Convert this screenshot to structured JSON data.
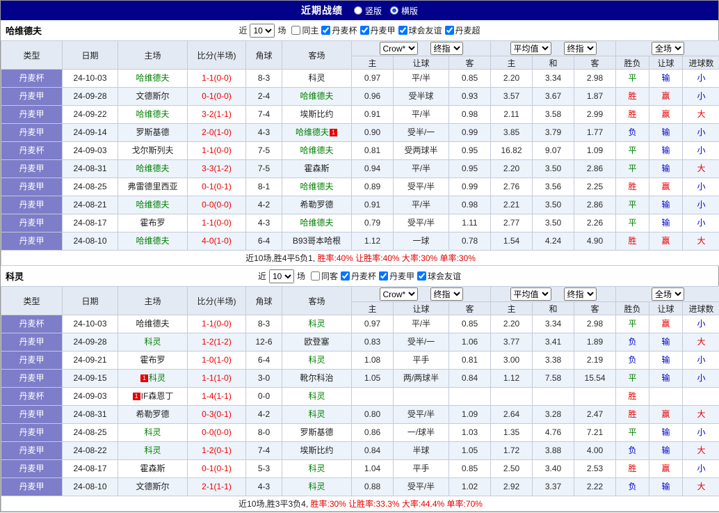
{
  "page": {
    "title": "近期战绩",
    "view_options": [
      {
        "label": "竖版",
        "selected": false
      },
      {
        "label": "横版",
        "selected": true
      }
    ]
  },
  "labels": {
    "near": "近",
    "games": "场"
  },
  "table": {
    "cols": [
      "类型",
      "日期",
      "主场",
      "比分(半场)",
      "角球",
      "客场"
    ],
    "groups": [
      {
        "selects": [
          "Crow*",
          "终指"
        ],
        "sub": [
          "主",
          "让球",
          "客"
        ]
      },
      {
        "selects": [
          "平均值",
          "终指"
        ],
        "sub": [
          "主",
          "和",
          "客"
        ]
      },
      {
        "selects": [
          "全场"
        ],
        "sub": [
          "胜负",
          "让球",
          "进球数"
        ]
      }
    ]
  },
  "result_colors": {
    "胜": "#e60000",
    "负": "#0000cc",
    "平": "#008000",
    "赢": "#e60000",
    "输": "#0000cc",
    "大": "#e60000",
    "小": "#0000cc"
  },
  "sections": [
    {
      "team": "哈维德夫",
      "filter": {
        "count": "10",
        "checkboxes": [
          {
            "label": "同主",
            "checked": false
          },
          {
            "label": "丹麦杯",
            "checked": true
          },
          {
            "label": "丹麦甲",
            "checked": true
          },
          {
            "label": "球会友谊",
            "checked": true
          },
          {
            "label": "丹麦超",
            "checked": true
          }
        ]
      },
      "rows": [
        {
          "type": "丹麦杯",
          "date": "24-10-03",
          "home": "哈维德夫",
          "home_focus": true,
          "score": "1-1(0-0)",
          "corner": "8-3",
          "away": "科灵",
          "odds": [
            "0.97",
            "平/半",
            "0.85"
          ],
          "avg": [
            "2.20",
            "3.34",
            "2.98"
          ],
          "results": [
            "平",
            "输",
            "小"
          ]
        },
        {
          "type": "丹麦甲",
          "date": "24-09-28",
          "home": "文德斯尔",
          "score": "0-1(0-0)",
          "corner": "2-4",
          "away": "哈维德夫",
          "away_focus": true,
          "odds": [
            "0.96",
            "受半球",
            "0.93"
          ],
          "avg": [
            "3.57",
            "3.67",
            "1.87"
          ],
          "results": [
            "胜",
            "赢",
            "小"
          ]
        },
        {
          "type": "丹麦甲",
          "date": "24-09-22",
          "home": "哈维德夫",
          "home_focus": true,
          "score": "3-2(1-1)",
          "corner": "7-4",
          "away": "埃斯比约",
          "odds": [
            "0.91",
            "平/半",
            "0.98"
          ],
          "avg": [
            "2.11",
            "3.58",
            "2.99"
          ],
          "results": [
            "胜",
            "赢",
            "大"
          ]
        },
        {
          "type": "丹麦甲",
          "date": "24-09-14",
          "home": "罗斯基德",
          "score": "2-0(1-0)",
          "corner": "4-3",
          "away": "哈维德夫",
          "away_focus": true,
          "away_badge": {
            "text": "1",
            "pos": "post"
          },
          "odds": [
            "0.90",
            "受半/一",
            "0.99"
          ],
          "avg": [
            "3.85",
            "3.79",
            "1.77"
          ],
          "results": [
            "负",
            "输",
            "小"
          ]
        },
        {
          "type": "丹麦杯",
          "date": "24-09-03",
          "home": "戈尔斯列夫",
          "score": "1-1(0-0)",
          "corner": "7-5",
          "away": "哈维德夫",
          "away_focus": true,
          "odds": [
            "0.81",
            "受两球半",
            "0.95"
          ],
          "avg": [
            "16.82",
            "9.07",
            "1.09"
          ],
          "results": [
            "平",
            "输",
            "小"
          ]
        },
        {
          "type": "丹麦甲",
          "date": "24-08-31",
          "home": "哈维德夫",
          "home_focus": true,
          "score": "3-3(1-2)",
          "corner": "7-5",
          "away": "霍森斯",
          "odds": [
            "0.94",
            "平/半",
            "0.95"
          ],
          "avg": [
            "2.20",
            "3.50",
            "2.86"
          ],
          "results": [
            "平",
            "输",
            "大"
          ]
        },
        {
          "type": "丹麦甲",
          "date": "24-08-25",
          "home": "弗雷德里西亚",
          "score": "0-1(0-1)",
          "corner": "8-1",
          "away": "哈维德夫",
          "away_focus": true,
          "odds": [
            "0.89",
            "受平/半",
            "0.99"
          ],
          "avg": [
            "2.76",
            "3.56",
            "2.25"
          ],
          "results": [
            "胜",
            "赢",
            "小"
          ]
        },
        {
          "type": "丹麦甲",
          "date": "24-08-21",
          "home": "哈维德夫",
          "home_focus": true,
          "score": "0-0(0-0)",
          "corner": "4-2",
          "away": "希勒罗德",
          "odds": [
            "0.91",
            "平/半",
            "0.98"
          ],
          "avg": [
            "2.21",
            "3.50",
            "2.86"
          ],
          "results": [
            "平",
            "输",
            "小"
          ]
        },
        {
          "type": "丹麦甲",
          "date": "24-08-17",
          "home": "霍布罗",
          "score": "1-1(0-0)",
          "corner": "4-3",
          "away": "哈维德夫",
          "away_focus": true,
          "odds": [
            "0.79",
            "受平/半",
            "1.11"
          ],
          "avg": [
            "2.77",
            "3.50",
            "2.26"
          ],
          "results": [
            "平",
            "输",
            "小"
          ]
        },
        {
          "type": "丹麦甲",
          "date": "24-08-10",
          "home": "哈维德夫",
          "home_focus": true,
          "score": "4-0(1-0)",
          "corner": "6-4",
          "away": "B93哥本哈根",
          "odds": [
            "1.12",
            "一球",
            "0.78"
          ],
          "avg": [
            "1.54",
            "4.24",
            "4.90"
          ],
          "results": [
            "胜",
            "赢",
            "大"
          ]
        }
      ],
      "footer": {
        "prefix": "近10场,胜4平5负1, ",
        "stats": "胜率:40% 让胜率:40% 大率:30% 单率:30%"
      }
    },
    {
      "team": "科灵",
      "filter": {
        "count": "10",
        "checkboxes": [
          {
            "label": "同客",
            "checked": false
          },
          {
            "label": "丹麦杯",
            "checked": true
          },
          {
            "label": "丹麦甲",
            "checked": true
          },
          {
            "label": "球会友谊",
            "checked": true
          }
        ]
      },
      "rows": [
        {
          "type": "丹麦杯",
          "date": "24-10-03",
          "home": "哈维德夫",
          "score": "1-1(0-0)",
          "corner": "8-3",
          "away": "科灵",
          "away_focus": true,
          "odds": [
            "0.97",
            "平/半",
            "0.85"
          ],
          "avg": [
            "2.20",
            "3.34",
            "2.98"
          ],
          "results": [
            "平",
            "赢",
            "小"
          ]
        },
        {
          "type": "丹麦甲",
          "date": "24-09-28",
          "home": "科灵",
          "home_focus": true,
          "score": "1-2(1-2)",
          "corner": "12-6",
          "away": "欧登塞",
          "odds": [
            "0.83",
            "受半/一",
            "1.06"
          ],
          "avg": [
            "3.77",
            "3.41",
            "1.89"
          ],
          "results": [
            "负",
            "输",
            "大"
          ]
        },
        {
          "type": "丹麦甲",
          "date": "24-09-21",
          "home": "霍布罗",
          "score": "1-0(1-0)",
          "corner": "6-4",
          "away": "科灵",
          "away_focus": true,
          "odds": [
            "1.08",
            "平手",
            "0.81"
          ],
          "avg": [
            "3.00",
            "3.38",
            "2.19"
          ],
          "results": [
            "负",
            "输",
            "小"
          ]
        },
        {
          "type": "丹麦甲",
          "date": "24-09-15",
          "home": "科灵",
          "home_focus": true,
          "home_badge": {
            "text": "1",
            "pos": "pre"
          },
          "score": "1-1(1-0)",
          "corner": "3-0",
          "away": "靴尔科治",
          "odds": [
            "1.05",
            "两/两球半",
            "0.84"
          ],
          "avg": [
            "1.12",
            "7.58",
            "15.54"
          ],
          "results": [
            "平",
            "输",
            "小"
          ]
        },
        {
          "type": "丹麦杯",
          "date": "24-09-03",
          "home": "IF森恩丁",
          "home_badge": {
            "text": "1",
            "pos": "pre"
          },
          "score": "1-4(1-1)",
          "corner": "0-0",
          "away": "科灵",
          "away_focus": true,
          "odds": [
            "",
            "",
            ""
          ],
          "avg": [
            "",
            "",
            ""
          ],
          "results": [
            "胜",
            "",
            ""
          ]
        },
        {
          "type": "丹麦甲",
          "date": "24-08-31",
          "home": "希勒罗德",
          "score": "0-3(0-1)",
          "corner": "4-2",
          "away": "科灵",
          "away_focus": true,
          "odds": [
            "0.80",
            "受平/半",
            "1.09"
          ],
          "avg": [
            "2.64",
            "3.28",
            "2.47"
          ],
          "results": [
            "胜",
            "赢",
            "大"
          ]
        },
        {
          "type": "丹麦甲",
          "date": "24-08-25",
          "home": "科灵",
          "home_focus": true,
          "score": "0-0(0-0)",
          "corner": "8-0",
          "away": "罗斯基德",
          "odds": [
            "0.86",
            "一/球半",
            "1.03"
          ],
          "avg": [
            "1.35",
            "4.76",
            "7.21"
          ],
          "results": [
            "平",
            "输",
            "小"
          ]
        },
        {
          "type": "丹麦甲",
          "date": "24-08-22",
          "home": "科灵",
          "home_focus": true,
          "score": "1-2(0-1)",
          "corner": "7-4",
          "away": "埃斯比约",
          "odds": [
            "0.84",
            "半球",
            "1.05"
          ],
          "avg": [
            "1.72",
            "3.88",
            "4.00"
          ],
          "results": [
            "负",
            "输",
            "大"
          ]
        },
        {
          "type": "丹麦甲",
          "date": "24-08-17",
          "home": "霍森斯",
          "score": "0-1(0-1)",
          "corner": "5-3",
          "away": "科灵",
          "away_focus": true,
          "odds": [
            "1.04",
            "平手",
            "0.85"
          ],
          "avg": [
            "2.50",
            "3.40",
            "2.53"
          ],
          "results": [
            "胜",
            "赢",
            "小"
          ]
        },
        {
          "type": "丹麦甲",
          "date": "24-08-10",
          "home": "文德斯尔",
          "score": "2-1(1-1)",
          "corner": "4-3",
          "away": "科灵",
          "away_focus": true,
          "odds": [
            "0.88",
            "受平/半",
            "1.02"
          ],
          "avg": [
            "2.92",
            "3.37",
            "2.22"
          ],
          "results": [
            "负",
            "输",
            "大"
          ]
        }
      ],
      "footer": {
        "prefix": "近10场,胜3平3负4, ",
        "stats": "胜率:30% 让胜率:33.3% 大率:44.4% 单率:70%"
      }
    }
  ]
}
